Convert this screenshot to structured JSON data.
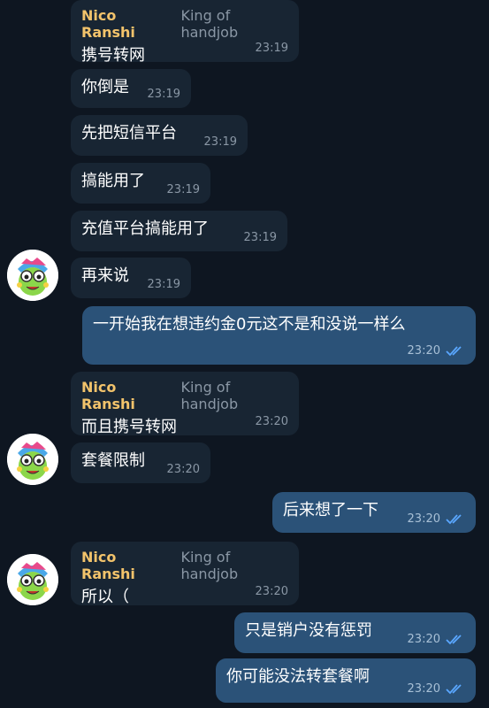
{
  "sender": {
    "name": "Nico Ranshi",
    "title": "King of handjob"
  },
  "messages": [
    {
      "text": "携号转网",
      "time": "23:19"
    },
    {
      "text": "你倒是",
      "time": "23:19"
    },
    {
      "text": "先把短信平台",
      "time": "23:19"
    },
    {
      "text": "搞能用了",
      "time": "23:19"
    },
    {
      "text": "充值平台搞能用了",
      "time": "23:19"
    },
    {
      "text": "再来说",
      "time": "23:19"
    },
    {
      "text": "一开始我在想违约金0元这不是和没说一样么",
      "time": "23:20"
    },
    {
      "text": "而且携号转网",
      "time": "23:20"
    },
    {
      "text": "套餐限制",
      "time": "23:20"
    },
    {
      "text": "后来想了一下",
      "time": "23:20"
    },
    {
      "text": "所以（",
      "time": "23:20"
    },
    {
      "text": "只是销户没有惩罚",
      "time": "23:20"
    },
    {
      "text": "你可能没法转套餐啊",
      "time": "23:20"
    }
  ],
  "colors": {
    "background": "#0e1621",
    "incoming_bubble": "#182533",
    "outgoing_bubble": "#2b5278",
    "sender_name": "#f2c36b",
    "read_ticks": "#5aa7ff"
  }
}
